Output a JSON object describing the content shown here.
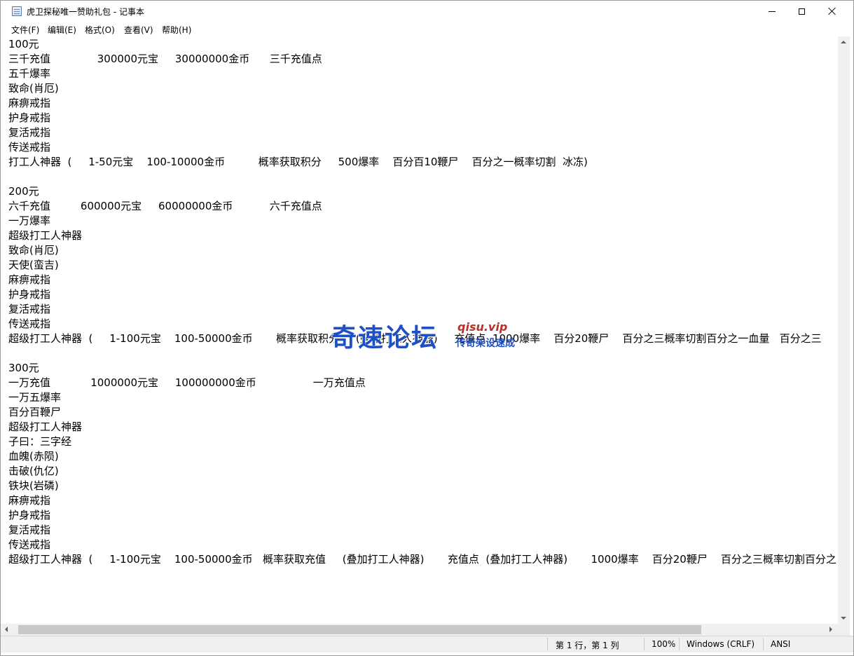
{
  "window": {
    "title": "虎卫探秘唯一赞助礼包 - 记事本",
    "app_icon": "notepad-icon"
  },
  "menu": {
    "items": [
      "文件(F)",
      "编辑(E)",
      "格式(O)",
      "查看(V)",
      "帮助(H)"
    ]
  },
  "content": {
    "lines": [
      "100元",
      "三千充值              300000元宝     30000000金币      三千充值点",
      "五千爆率",
      "致命(肖厄)",
      "麻痹戒指",
      "护身戒指",
      "复活戒指",
      "传送戒指",
      "打工人神器  (     1-50元宝    100-10000金币          概率获取积分     500爆率    百分百10鞭尸    百分之一概率切割  冰冻)",
      "",
      "200元",
      "六千充值         600000元宝     60000000金币           六千充值点",
      "一万爆率",
      "超级打工人神器",
      "致命(肖厄)",
      "天使(蛮吉)",
      "麻痹戒指",
      "护身戒指",
      "复活戒指",
      "传送戒指",
      "超级打工人神器  (     1-100元宝    100-50000金币       概率获取积分     (叠加打工人神器)     充值点  1000爆率    百分20鞭尸    百分之三概率切割百分之一血量   百分之三",
      "",
      "300元",
      "一万充值            1000000元宝     100000000金币                 一万充值点",
      "一万五爆率",
      "百分百鞭尸",
      "超级打工人神器",
      "子曰：三字经",
      "血魄(赤陨)",
      "击破(仇亿)",
      "铁块(岩磷)",
      "麻痹戒指",
      "护身戒指",
      "复活戒指",
      "传送戒指",
      "超级打工人神器  (     1-100元宝    100-50000金币   概率获取充值     (叠加打工人神器)       充值点  (叠加打工人神器)       1000爆率    百分20鞭尸    百分之三概率切割百分之"
    ]
  },
  "statusbar": {
    "position": "第 1 行，第 1 列",
    "zoom": "100%",
    "line_ending": "Windows (CRLF)",
    "encoding": "ANSI"
  },
  "watermark": {
    "main": "奇速论坛",
    "domain": "qisu.vip",
    "slogan": "传奇架设速成"
  }
}
